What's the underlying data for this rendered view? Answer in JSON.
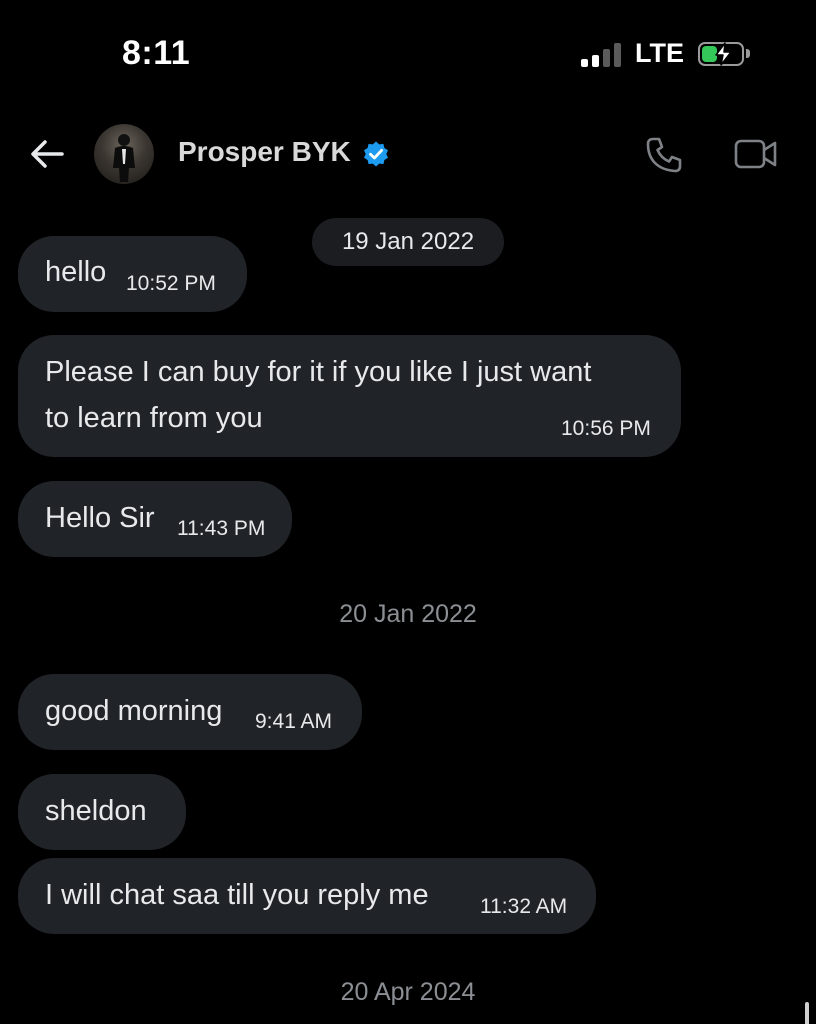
{
  "status_bar": {
    "time": "8:11",
    "network": "LTE",
    "signal_bars": 2,
    "battery_charging": true,
    "battery_level": 0.35,
    "battery_color": "#34c759"
  },
  "header": {
    "back_icon": "arrow-left-icon",
    "contact_name": "Prosper BYK",
    "verified_icon": "verified-badge-icon",
    "verified_color": "#1d9bf0",
    "call_icon": "phone-icon",
    "video_icon": "video-camera-icon"
  },
  "conversation": {
    "dates": [
      "19 Jan 2022",
      "20 Jan 2022",
      "20 Apr 2024"
    ],
    "messages": [
      {
        "text": "hello",
        "time": "10:52 PM"
      },
      {
        "text_line1": "Please I can buy for it if you like I just want",
        "text_line2": "to learn from you",
        "time": "10:56 PM"
      },
      {
        "text": "Hello Sir",
        "time": "11:43 PM"
      },
      {
        "text": "good morning",
        "time": "9:41 AM"
      },
      {
        "text": "sheldon",
        "time": ""
      },
      {
        "text": "I will chat saa till you reply me",
        "time": "11:32 AM"
      }
    ]
  },
  "colors": {
    "background": "#000000",
    "bubble": "#202327",
    "date_chip": "#1b1d21",
    "muted_text": "#8b8f94"
  }
}
